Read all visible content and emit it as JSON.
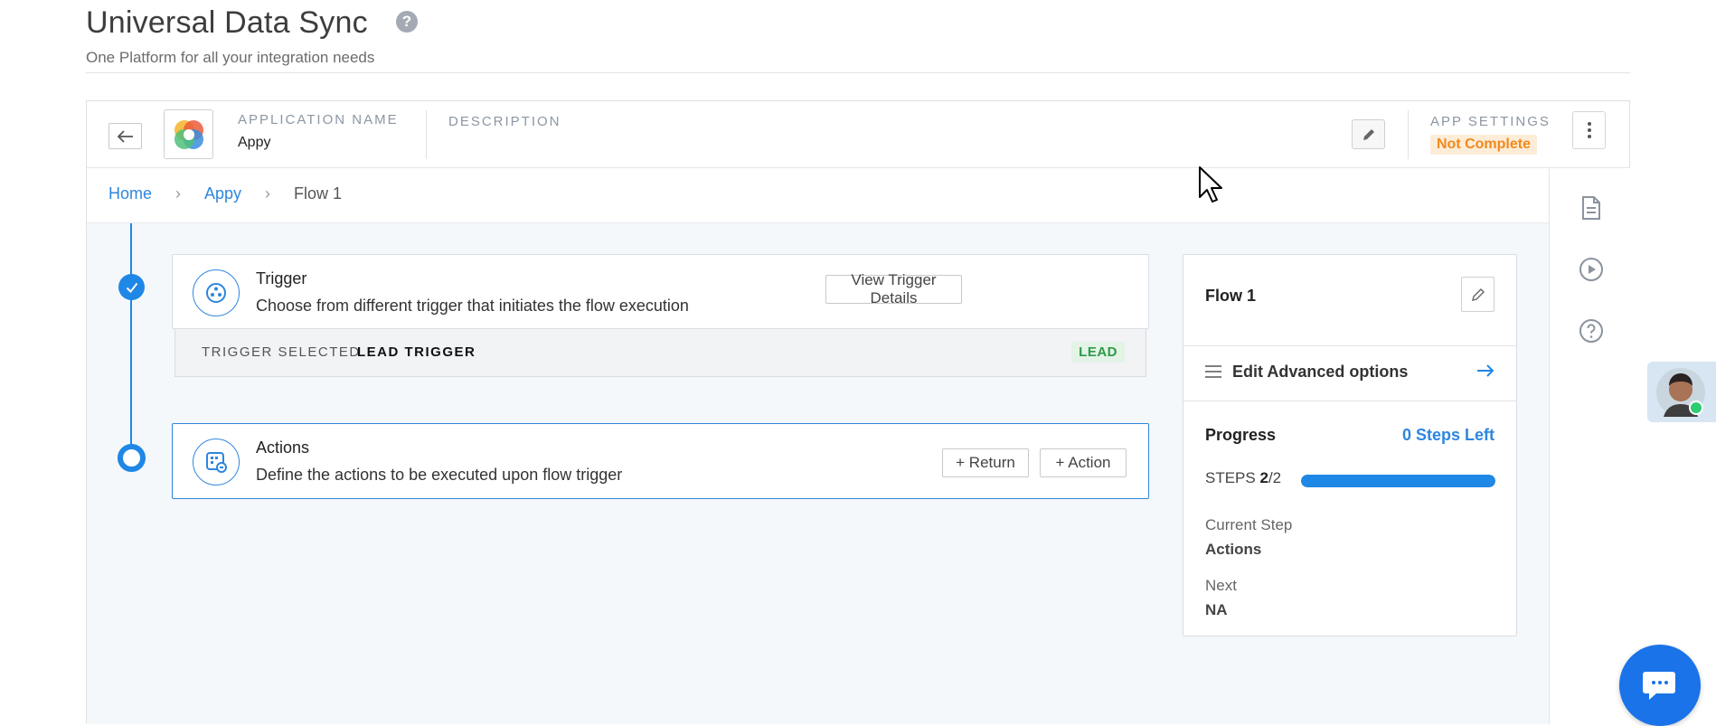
{
  "header": {
    "title": "Universal Data Sync",
    "subtitle": "One Platform for all your integration needs",
    "help_icon_glyph": "?"
  },
  "app_bar": {
    "application_name_label": "APPLICATION NAME",
    "application_name": "Appy",
    "description_label": "DESCRIPTION",
    "app_settings_label": "APP SETTINGS",
    "app_settings_status": "Not Complete"
  },
  "breadcrumb": {
    "items": [
      "Home",
      "Appy"
    ],
    "current": "Flow 1"
  },
  "trigger_card": {
    "title": "Trigger",
    "description": "Choose from different trigger that initiates the flow execution",
    "button": "View Trigger Details",
    "selected_label": "TRIGGER SELECTED",
    "selected_value": "LEAD TRIGGER",
    "badge": "LEAD"
  },
  "actions_card": {
    "title": "Actions",
    "description": "Define the actions to be executed upon flow trigger",
    "return_button": "+ Return",
    "action_button": "+ Action"
  },
  "flow_panel": {
    "name": "Flow 1",
    "advanced_options": "Edit Advanced options",
    "progress_title": "Progress",
    "steps_left": "0 Steps Left",
    "steps_label": "STEPS",
    "steps_done": "2",
    "steps_total": "/2",
    "progress_fraction": 1.0,
    "current_step_label": "Current Step",
    "current_step_value": "Actions",
    "next_label": "Next",
    "next_value": "NA"
  },
  "icons": {
    "back": "arrow-left-icon",
    "edit": "pencil-icon",
    "more": "kebab-menu-icon",
    "rail": [
      "document-icon",
      "play-circle-icon",
      "question-circle-icon"
    ],
    "chat": "chat-bubble-icon"
  },
  "colors": {
    "accent": "#1f87e5",
    "link": "#2e86de",
    "warning_text": "#f08a1c",
    "success_text": "#2e9a4a"
  }
}
